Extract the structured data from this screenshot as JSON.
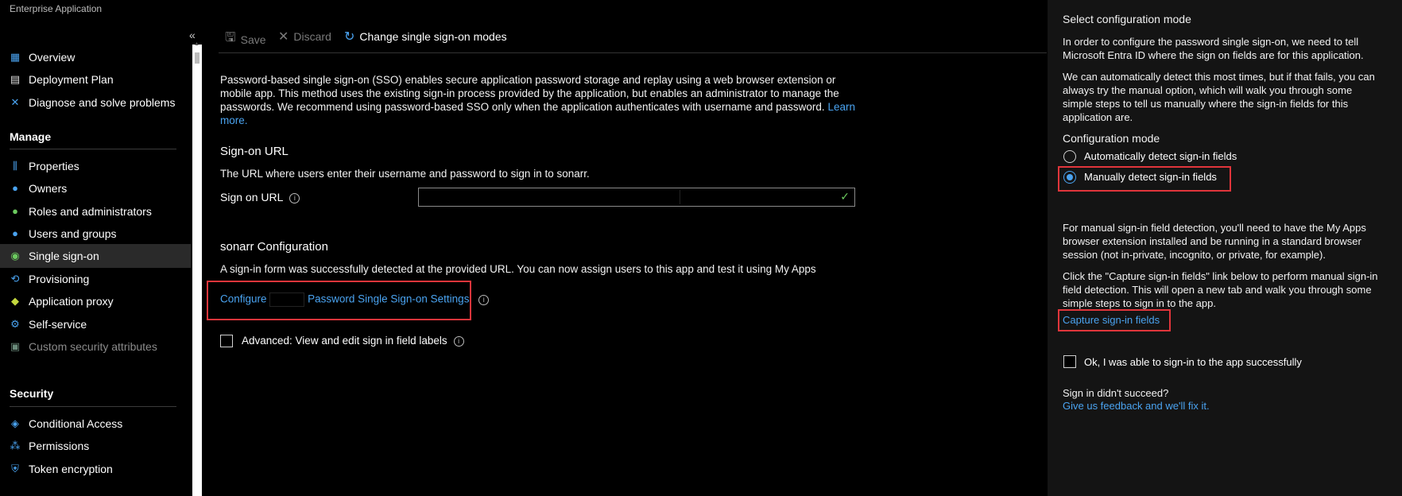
{
  "app": {
    "title": "Enterprise Application"
  },
  "sidebar": {
    "collapse_glyph": "«",
    "items_top": [
      {
        "label": "Overview",
        "icon": "grid-icon"
      },
      {
        "label": "Deployment Plan",
        "icon": "book-icon"
      },
      {
        "label": "Diagnose and solve problems",
        "icon": "wrench-icon"
      }
    ],
    "manage_header": "Manage",
    "manage_items": [
      {
        "label": "Properties",
        "icon": "sliders-icon"
      },
      {
        "label": "Owners",
        "icon": "people-icon"
      },
      {
        "label": "Roles and administrators",
        "icon": "person-icon"
      },
      {
        "label": "Users and groups",
        "icon": "users-icon"
      },
      {
        "label": "Single sign-on",
        "icon": "sso-icon"
      },
      {
        "label": "Provisioning",
        "icon": "provisioning-icon"
      },
      {
        "label": "Application proxy",
        "icon": "proxy-icon"
      },
      {
        "label": "Self-service",
        "icon": "self-service-icon"
      },
      {
        "label": "Custom security attributes",
        "icon": "tag-icon"
      }
    ],
    "security_header": "Security",
    "security_items": [
      {
        "label": "Conditional Access",
        "icon": "conditional-access-icon"
      },
      {
        "label": "Permissions",
        "icon": "permissions-icon"
      },
      {
        "label": "Token encryption",
        "icon": "shield-icon"
      }
    ]
  },
  "toolbar": {
    "save_label": "Save",
    "discard_label": "Discard",
    "change_modes_label": "Change single sign-on modes"
  },
  "main": {
    "intro": "Password-based single sign-on (SSO) enables secure application password storage and replay using a web browser extension or mobile app. This method uses the existing sign-in process provided by the application, but enables an administrator to manage the passwords. We recommend using password-based SSO only when the application authenticates with username and password.",
    "learn_more": "Learn more.",
    "signon_heading": "Sign-on URL",
    "signon_desc": "The URL where users enter their username and password to sign in to sonarr.",
    "signon_label": "Sign on URL",
    "config_heading": "sonarr Configuration",
    "config_desc": "A sign-in form was successfully detected at the provided URL. You can now assign users to this app and test it using My Apps",
    "configure_link_prefix": "Configure",
    "configure_link_suffix": "Password Single Sign-on Settings",
    "advanced_label": "Advanced: View and edit sign in field labels"
  },
  "panel": {
    "title": "Select configuration mode",
    "p1": "In order to configure the password single sign-on, we need to tell Microsoft Entra ID where the sign on fields are for this application.",
    "p2": "We can automatically detect this most times, but if that fails, you can always try the manual option, which will walk you through some simple steps to tell us manually where the sign-in fields for this application are.",
    "mode_heading": "Configuration mode",
    "radio_auto": "Automatically detect sign-in fields",
    "radio_manual": "Manually detect sign-in fields",
    "selected_mode": "Manually detect sign-in fields",
    "p3": "For manual sign-in field detection, you'll need to have the My Apps browser extension installed and be running in a standard browser session (not in-private, incognito, or private, for example).",
    "p4": "Click the \"Capture sign-in fields\" link below to perform manual sign-in field detection. This will open a new tab and walk you through some simple steps to sign in to the app.",
    "capture_link": "Capture sign-in fields",
    "ok_label": "Ok, I was able to sign-in to the app successfully",
    "fail_heading": "Sign in didn't succeed?",
    "feedback_link": "Give us feedback and we'll fix it."
  },
  "colors": {
    "accent": "#4aa3f0",
    "highlight": "#e0353b",
    "success": "#6ccb5f"
  }
}
